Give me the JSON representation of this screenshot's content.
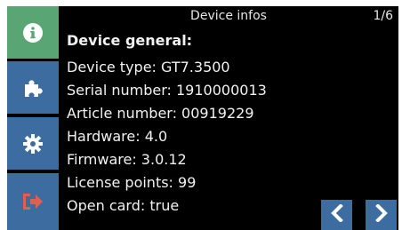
{
  "header": {
    "title": "Device infos",
    "page": "1/6"
  },
  "sidebar": {
    "items": [
      {
        "icon": "info-icon",
        "active": true
      },
      {
        "icon": "puzzle-icon",
        "active": false
      },
      {
        "icon": "gear-icon",
        "active": false
      },
      {
        "icon": "logout-icon",
        "active": false
      }
    ]
  },
  "content": {
    "heading": "Device general:",
    "lines": [
      "Device type: GT7.3500",
      "Serial number: 1910000013",
      "Article number: 00919229",
      "Hardware: 4.0",
      "Firmware: 3.0.12",
      "License points: 99",
      "Open card: true"
    ]
  },
  "navigation": {
    "prev_icon": "chevron-left-icon",
    "next_icon": "chevron-right-icon"
  },
  "colors": {
    "active_tab": "#5aa574",
    "button": "#3d6da0",
    "logout_icon": "#e0604f",
    "background": "#000000",
    "text": "#f2f2f2"
  }
}
